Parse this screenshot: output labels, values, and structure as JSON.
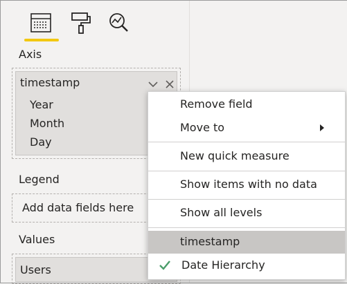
{
  "visualizations_pane": {
    "tabs": [
      {
        "label": "Fields",
        "icon": "fields-icon",
        "selected": true
      },
      {
        "label": "Format",
        "icon": "paint-roller-icon",
        "selected": false
      },
      {
        "label": "Analytics",
        "icon": "analytics-icon",
        "selected": false
      }
    ],
    "accent_color": "#f2c811",
    "axis": {
      "label": "Axis",
      "field": {
        "name": "timestamp",
        "hierarchy_items": [
          "Year",
          "Month",
          "Day"
        ],
        "chevron_icon": "chevron-down-icon",
        "remove_icon": "close-icon"
      }
    },
    "legend": {
      "label": "Legend",
      "placeholder": "Add data fields here"
    },
    "values": {
      "label": "Values",
      "field": {
        "name": "Users"
      }
    }
  },
  "context_menu": {
    "items": [
      {
        "label": "Remove field"
      },
      {
        "label": "Move to",
        "has_submenu": true
      },
      {
        "label": "New quick measure"
      },
      {
        "label": "Show items with no data"
      },
      {
        "label": "Show all levels"
      },
      {
        "label": "timestamp",
        "selected": true
      },
      {
        "label": "Date Hierarchy",
        "checked": true
      }
    ],
    "check_color": "#4a9d6a",
    "selected_color": "#c8c6c4"
  }
}
